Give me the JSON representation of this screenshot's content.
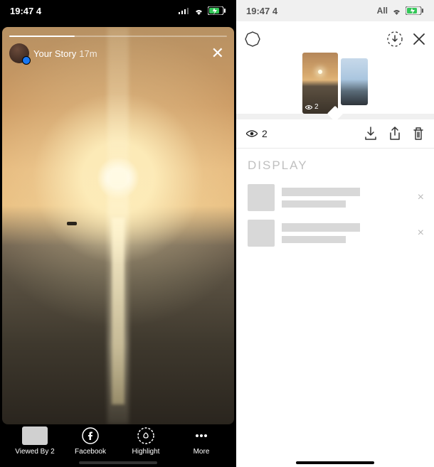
{
  "statusbar": {
    "time": "19:47 4",
    "carrier": "All"
  },
  "left": {
    "story": {
      "title": "Your Story",
      "age": "17m",
      "close": "✕"
    },
    "bottom": {
      "viewed": {
        "label": "Viewed By",
        "count": "2"
      },
      "facebook_label": "Facebook",
      "highlight_label": "Highlight",
      "more_label": "More"
    }
  },
  "right": {
    "thumb1_views": "2",
    "stats": {
      "views": "2"
    },
    "display_label": "DISPLAY",
    "list_x": "×"
  }
}
